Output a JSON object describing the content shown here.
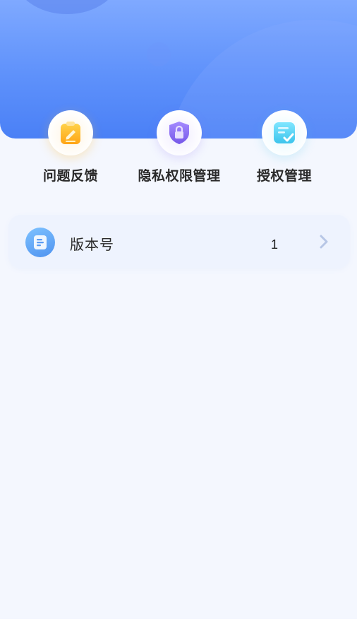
{
  "actions": [
    {
      "label": "问题反馈",
      "icon": "clipboard-edit-icon",
      "color": "#ffb21e"
    },
    {
      "label": "隐私权限管理",
      "icon": "shield-lock-icon",
      "color": "#8a6cf0"
    },
    {
      "label": "授权管理",
      "icon": "checklist-icon",
      "color": "#4fd3f0"
    }
  ],
  "version": {
    "label": "版本号",
    "value": "1",
    "icon": "document-icon"
  },
  "colors": {
    "header_top": "#7fa9ff",
    "header_bottom": "#4a80f6",
    "page_bg": "#f4f7fe"
  }
}
